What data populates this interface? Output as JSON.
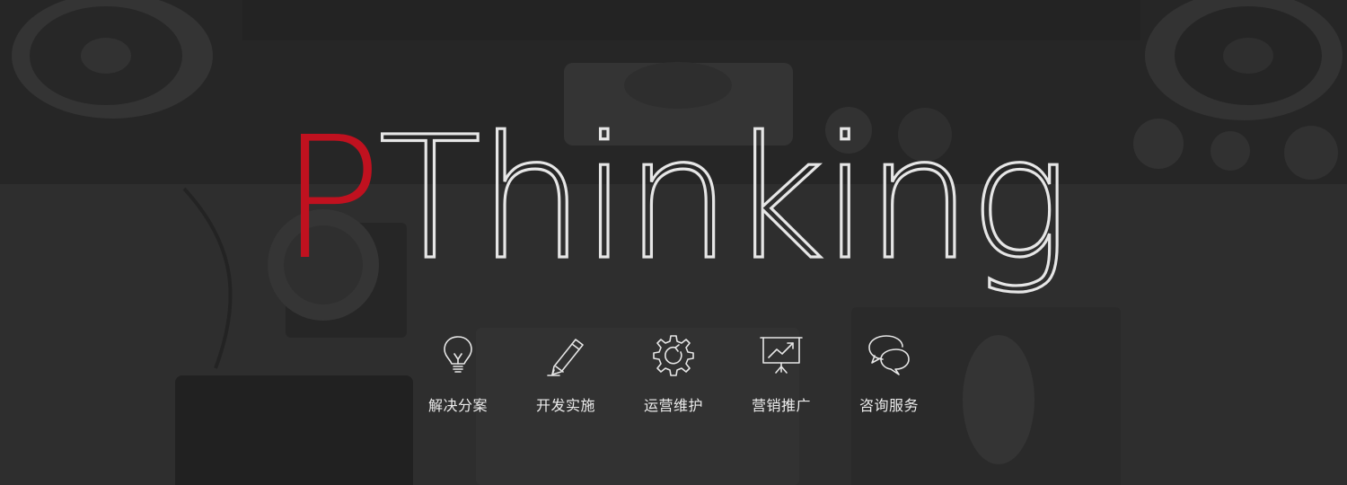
{
  "brand": {
    "initial": "P",
    "rest": "Thinking",
    "accent_color": "#c0111f",
    "text_color": "#e6e6e6"
  },
  "services": [
    {
      "label": "解决分案",
      "icon": "lightbulb-icon"
    },
    {
      "label": "开发实施",
      "icon": "pencil-icon"
    },
    {
      "label": "运营维护",
      "icon": "gear-icon"
    },
    {
      "label": "营销推广",
      "icon": "presentation-chart-icon"
    },
    {
      "label": "咨询服务",
      "icon": "chat-bubbles-icon"
    }
  ]
}
